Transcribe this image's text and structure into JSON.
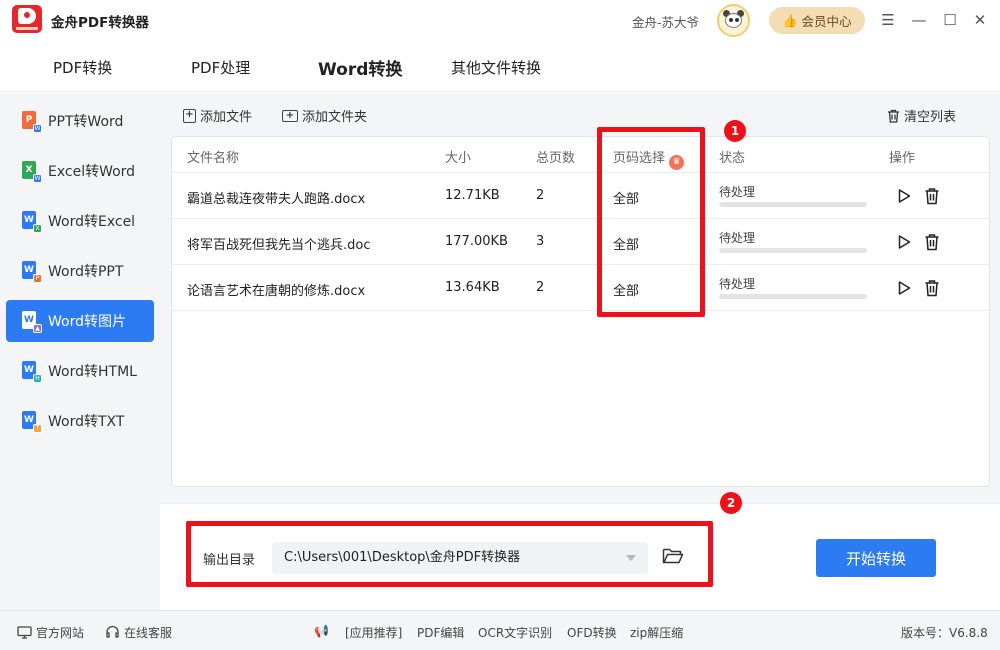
{
  "app": {
    "title": "金舟PDF转换器",
    "user_name": "金舟-苏大爷",
    "member_label": "会员中心"
  },
  "tabs": [
    {
      "label": "PDF转换"
    },
    {
      "label": "PDF处理"
    },
    {
      "label": "Word转换"
    },
    {
      "label": "其他文件转换"
    }
  ],
  "sidebar": {
    "items": [
      {
        "label": "PPT转Word",
        "icon": "P",
        "sub": "W"
      },
      {
        "label": "Excel转Word",
        "icon": "X",
        "sub": "W"
      },
      {
        "label": "Word转Excel",
        "icon": "W",
        "sub": "X"
      },
      {
        "label": "Word转PPT",
        "icon": "W",
        "sub": "P"
      },
      {
        "label": "Word转图片",
        "icon": "W",
        "sub": "▲"
      },
      {
        "label": "Word转HTML",
        "icon": "W",
        "sub": "H"
      },
      {
        "label": "Word转TXT",
        "icon": "W",
        "sub": "T"
      }
    ]
  },
  "toolbar": {
    "add_file": "添加文件",
    "add_folder": "添加文件夹",
    "clear_list": "清空列表"
  },
  "table": {
    "headers": {
      "name": "文件名称",
      "size": "大小",
      "pages": "总页数",
      "page_select": "页码选择",
      "status": "状态",
      "action": "操作"
    },
    "rows": [
      {
        "name": "霸道总裁连夜带夫人跑路.docx",
        "size": "12.71KB",
        "pages": "2",
        "page_select": "全部",
        "status": "待处理",
        "progress": 0
      },
      {
        "name": "将军百战死但我先当个逃兵.doc",
        "size": "177.00KB",
        "pages": "3",
        "page_select": "全部",
        "status": "待处理",
        "progress": 0
      },
      {
        "name": "论语言艺术在唐朝的修炼.docx",
        "size": "13.64KB",
        "pages": "2",
        "page_select": "全部",
        "status": "待处理",
        "progress": 0
      }
    ]
  },
  "output": {
    "label": "输出目录",
    "path": "C:\\Users\\001\\Desktop\\金舟PDF转换器",
    "start_label": "开始转换"
  },
  "annotations": {
    "badge1": "1",
    "badge2": "2"
  },
  "footer": {
    "website": "官方网站",
    "service": "在线客服",
    "recommend": "[应用推荐]",
    "links": [
      "PDF编辑",
      "OCR文字识别",
      "OFD转换",
      "zip解压缩"
    ],
    "version": "版本号：V6.8.8"
  },
  "colors": {
    "accent": "#2d7bf3",
    "annotation": "#f0101a",
    "sidebar_bg": "#f4f5f7"
  }
}
